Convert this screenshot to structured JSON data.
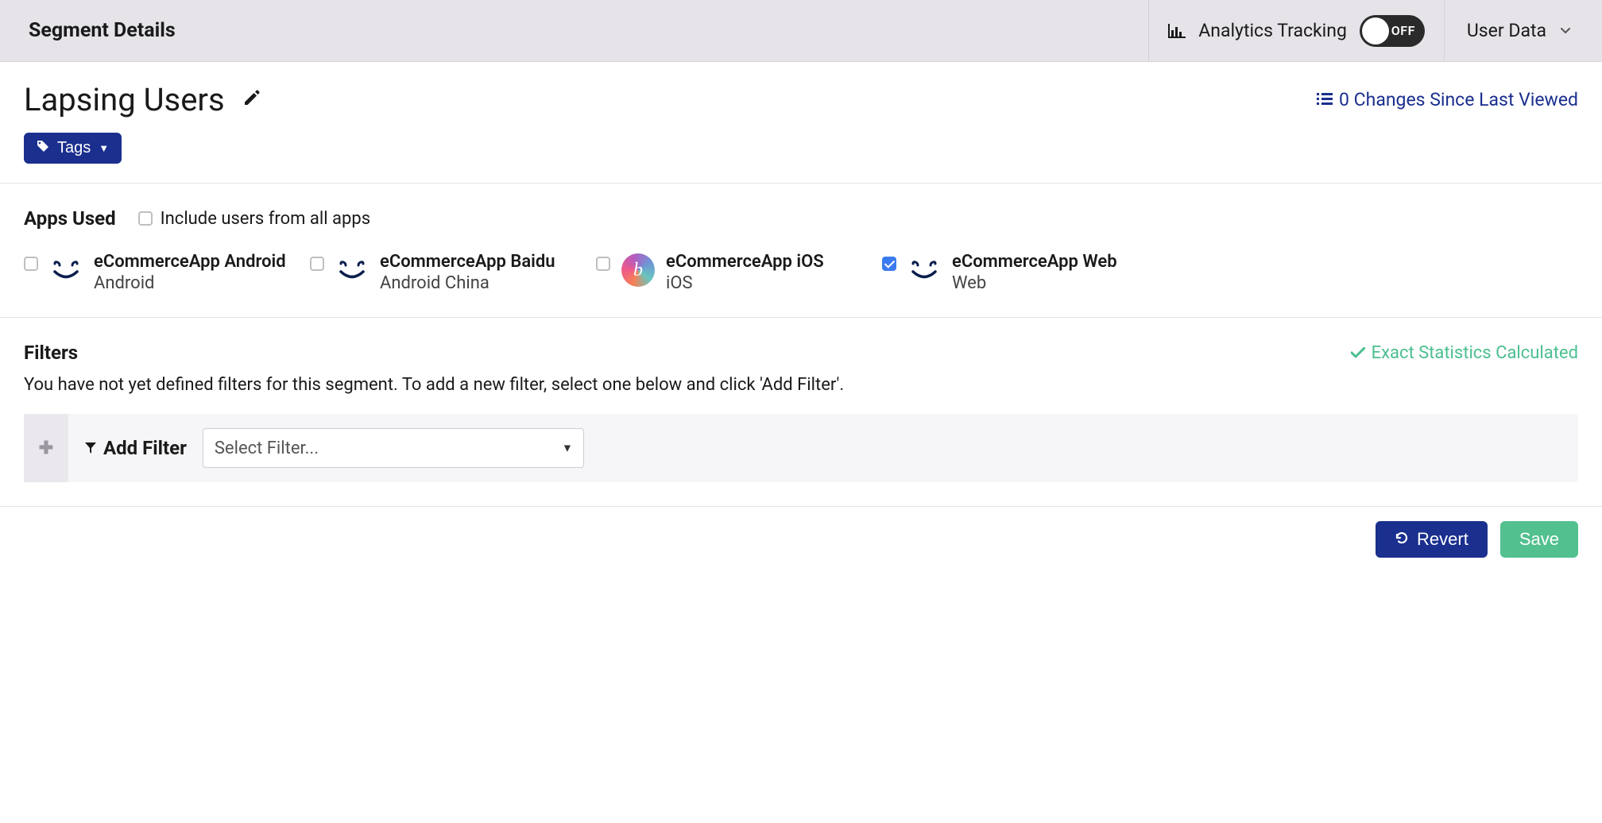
{
  "topbar": {
    "title": "Segment Details",
    "tracking_label": "Analytics Tracking",
    "toggle_state": "OFF",
    "user_data_label": "User Data"
  },
  "segment": {
    "name": "Lapsing Users",
    "changes_label": "0 Changes Since Last Viewed",
    "tags_btn_label": "Tags"
  },
  "apps": {
    "section_title": "Apps Used",
    "include_all_label": "Include users from all apps",
    "items": [
      {
        "name": "eCommerceApp Android",
        "platform": "Android",
        "checked": false,
        "icon": "smile"
      },
      {
        "name": "eCommerceApp Baidu",
        "platform": "Android China",
        "checked": false,
        "icon": "smile"
      },
      {
        "name": "eCommerceApp iOS",
        "platform": "iOS",
        "checked": false,
        "icon": "grad",
        "icon_letter": "b"
      },
      {
        "name": "eCommerceApp Web",
        "platform": "Web",
        "checked": true,
        "icon": "smile"
      }
    ]
  },
  "filters": {
    "section_title": "Filters",
    "status_text": "Exact Statistics Calculated",
    "desc": "You have not yet defined filters for this segment. To add a new filter, select one below and click 'Add Filter'.",
    "add_filter_label": "Add Filter",
    "select_placeholder": "Select Filter..."
  },
  "footer": {
    "revert_label": "Revert",
    "save_label": "Save"
  }
}
